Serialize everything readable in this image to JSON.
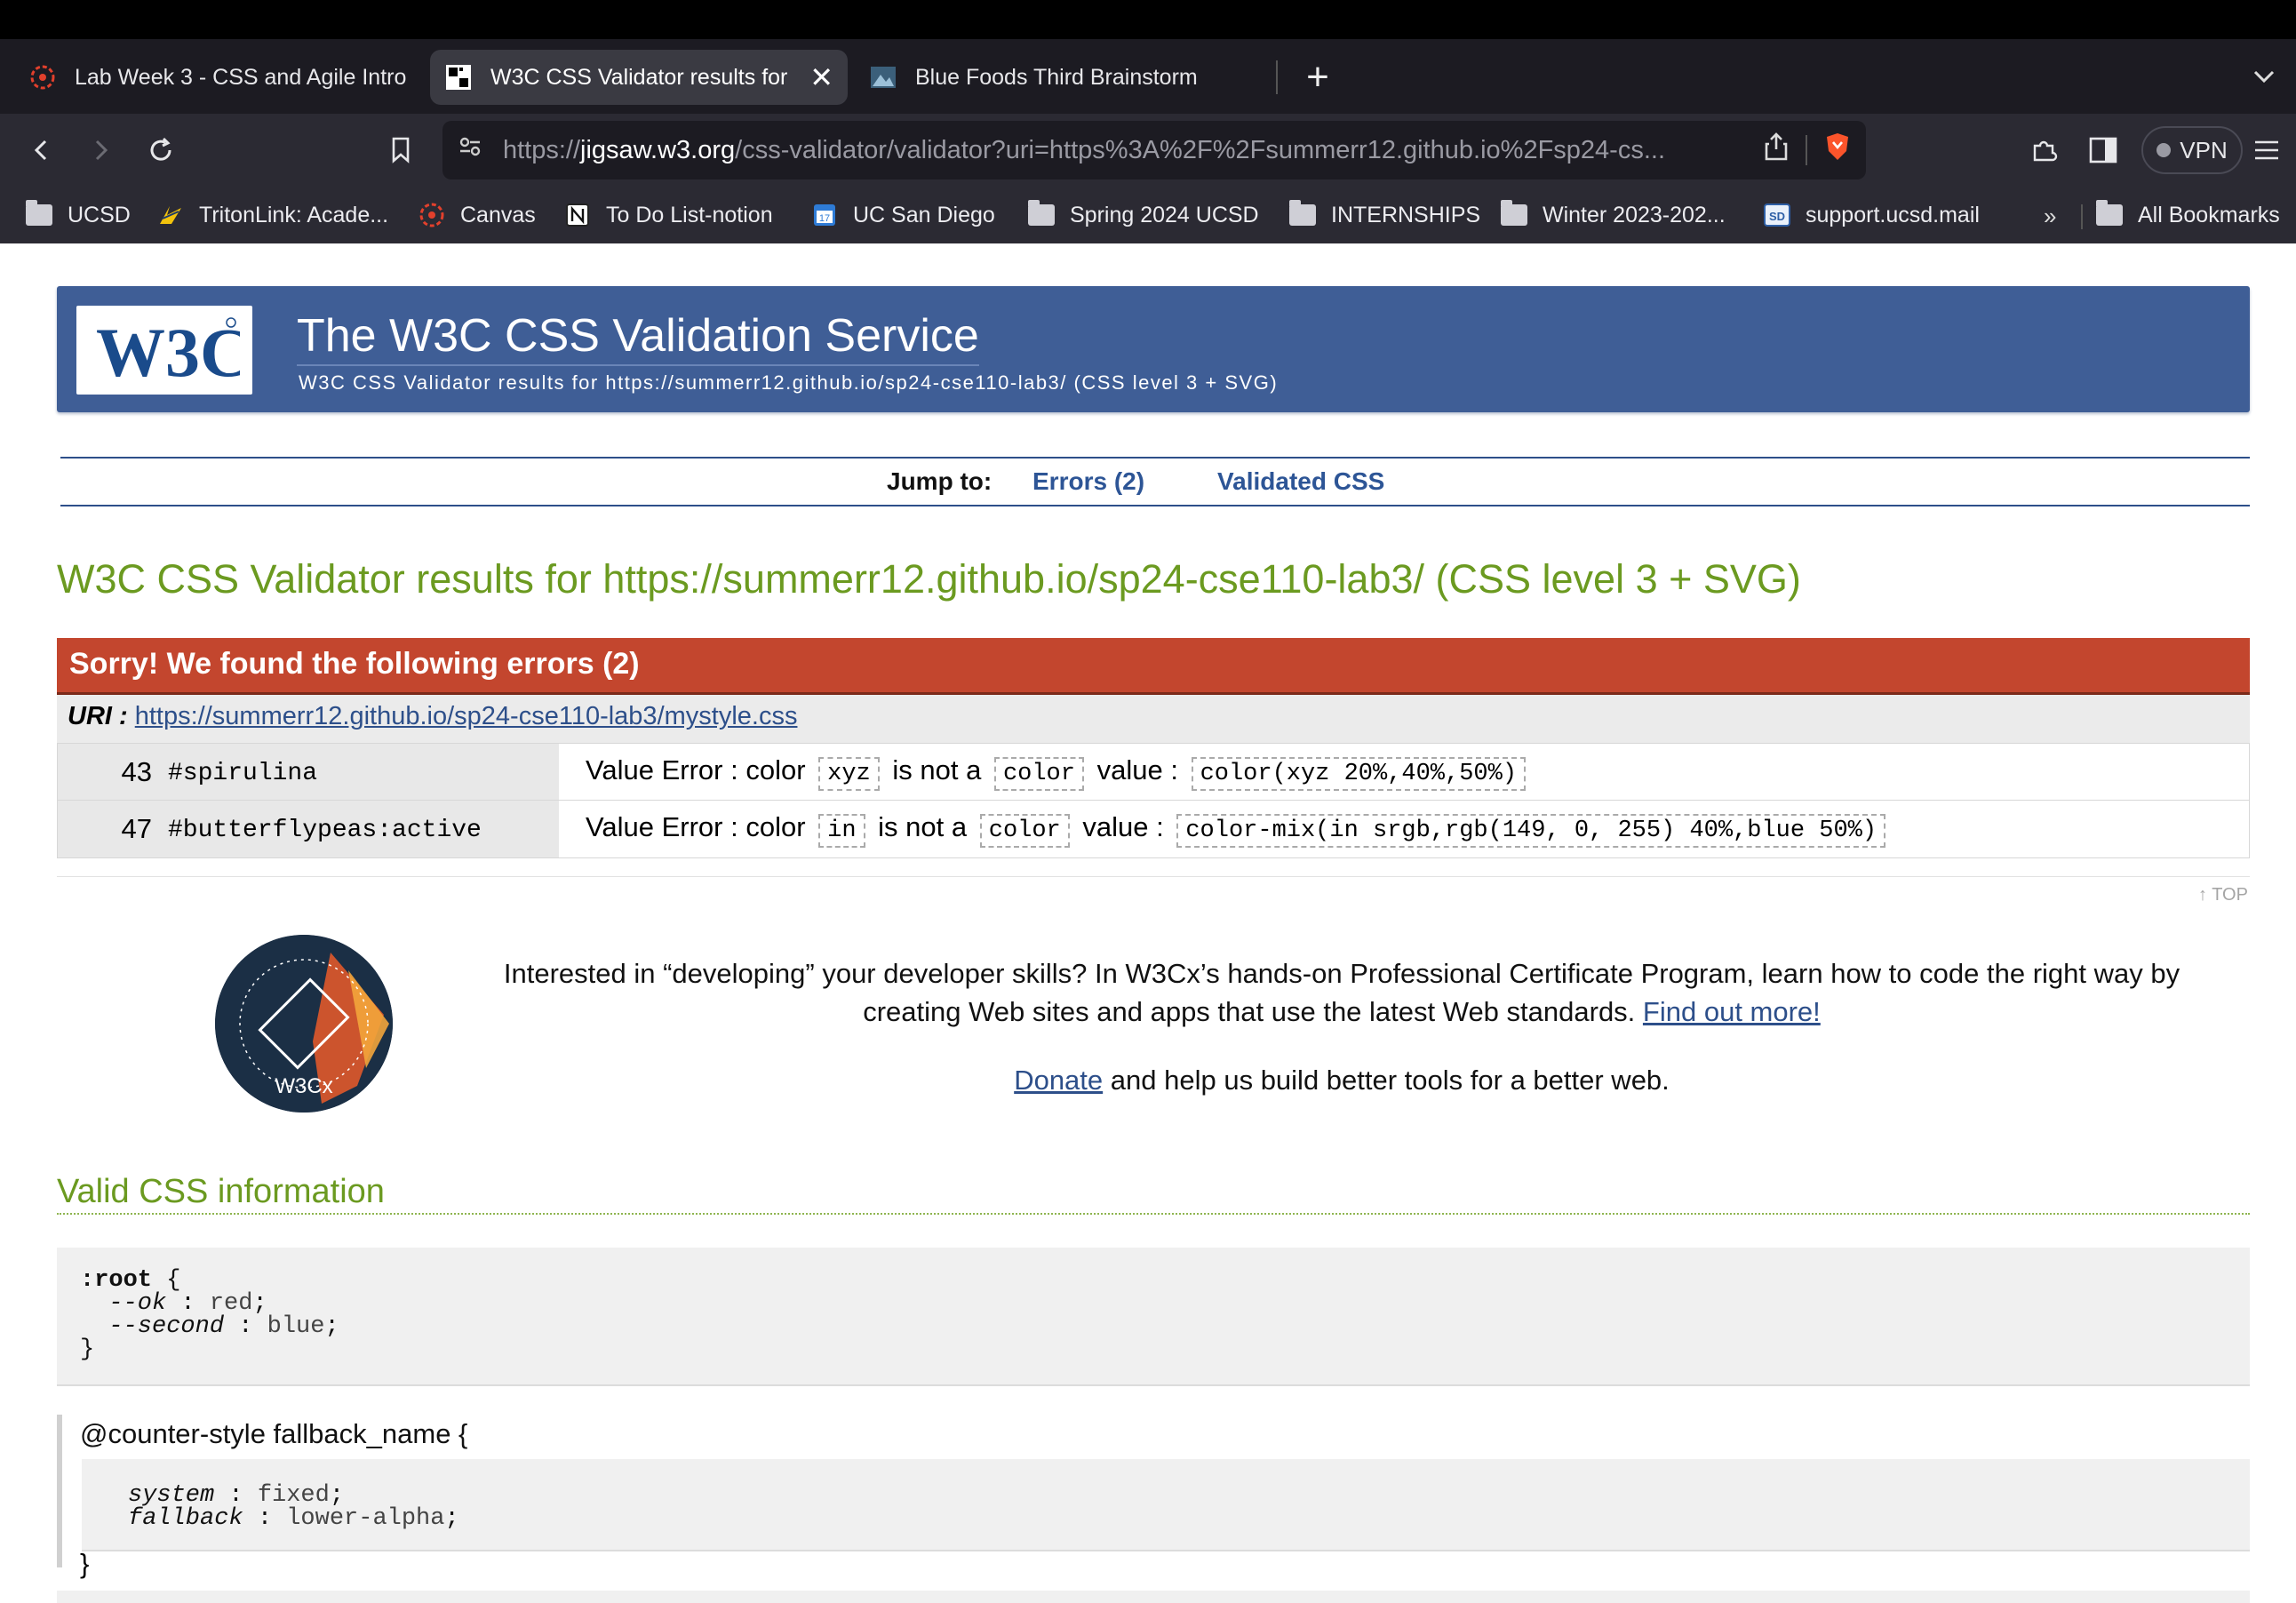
{
  "browser": {
    "tabs": [
      {
        "title": "Lab Week 3 - CSS and Agile Intro",
        "active": false,
        "icon": "canvas-icon"
      },
      {
        "title": "W3C CSS Validator results for",
        "active": true,
        "icon": "w3c-icon"
      },
      {
        "title": "Blue Foods Third Brainstorm",
        "active": false,
        "icon": "image-icon"
      }
    ],
    "close_glyph": "✕",
    "new_tab_glyph": "+",
    "url": {
      "prefix": "https://",
      "host": "jigsaw.w3.org",
      "path": "/css-validator/validator?uri=https%3A%2F%2Fsummerr12.github.io%2Fsp24-cs..."
    },
    "vpn_label": "VPN",
    "bookmarks": [
      {
        "label": "UCSD",
        "icon": "folder-icon"
      },
      {
        "label": "TritonLink: Acade...",
        "icon": "tritonlink-icon"
      },
      {
        "label": "Canvas",
        "icon": "canvas-icon"
      },
      {
        "label": "To Do List-notion",
        "icon": "notion-icon"
      },
      {
        "label": "UC San Diego",
        "icon": "calendar-icon"
      },
      {
        "label": "Spring 2024 UCSD",
        "icon": "folder-icon"
      },
      {
        "label": "INTERNSHIPS",
        "icon": "folder-icon"
      },
      {
        "label": "Winter 2023-202...",
        "icon": "folder-icon"
      },
      {
        "label": "support.ucsd.mail",
        "icon": "sd-icon"
      }
    ],
    "bookmarks_more": "»",
    "all_bookmarks": "All Bookmarks"
  },
  "header": {
    "logo_text": "W3C",
    "title": "The W3C CSS Validation Service",
    "subtitle": "W3C CSS Validator results for https://summerr12.github.io/sp24-cse110-lab3/ (CSS level 3 + SVG)"
  },
  "jump": {
    "label": "Jump to:",
    "errors_link": "Errors (2)",
    "validated_link": "Validated CSS"
  },
  "results_title": "W3C CSS Validator results for https://summerr12.github.io/sp24-cse110-lab3/ (CSS level 3 + SVG)",
  "errors": {
    "heading": "Sorry! We found the following errors (2)",
    "uri_label": "URI :",
    "uri": "https://summerr12.github.io/sp24-cse110-lab3/mystyle.css",
    "rows": [
      {
        "line": "43",
        "context": "#spirulina",
        "prefix": "Value Error : color",
        "token": "xyz",
        "mid": "is not a",
        "type": "color",
        "value_label": "value :",
        "value": "color(xyz 20%,40%,50%)"
      },
      {
        "line": "47",
        "context": "#butterflypeas:active",
        "prefix": "Value Error : color",
        "token": "in",
        "mid": "is not a",
        "type": "color",
        "value_label": "value :",
        "value": "color-mix(in srgb,rgb(149, 0, 255) 40%,blue 50%)"
      }
    ]
  },
  "top_link": "↑ TOP",
  "promo": {
    "badge_text": "W3Cx",
    "text": "Interested in “developing” your developer skills? In W3Cx’s hands-on Professional Certificate Program, learn how to code the right way by creating Web sites and apps that use the latest Web standards.",
    "link": "Find out more!",
    "donate_link": "Donate",
    "donate_text": "and help us build better tools for a better web."
  },
  "valid": {
    "title": "Valid CSS information",
    "root_selector": ":root",
    "root_decls": [
      {
        "prop": "--ok",
        "value": "red"
      },
      {
        "prop": "--second",
        "value": "blue"
      }
    ],
    "counter_head": "@counter-style fallback_name {",
    "counter_decls": [
      {
        "prop": "system",
        "value": "fixed"
      },
      {
        "prop": "fallback",
        "value": "lower-alpha"
      }
    ],
    "close_brace": "}"
  },
  "colors": {
    "banner": "#3f5e96",
    "error_header": "#c3462e",
    "results_green": "#6b9a20",
    "link_blue": "#2d4f8a"
  }
}
